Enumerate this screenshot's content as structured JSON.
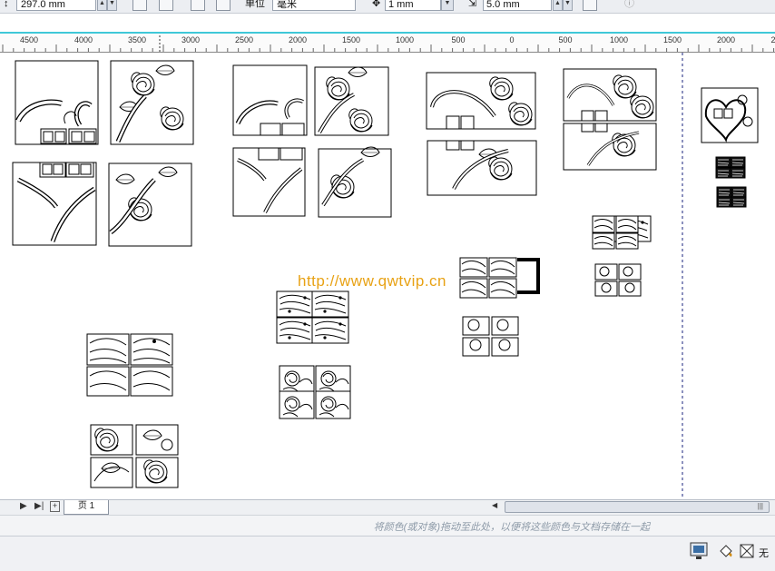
{
  "toolbar": {
    "page_height_value": "297.0 mm",
    "nudge_value": "1 mm",
    "duplicate_distance_value": "5.0 mm",
    "units_label": "单位",
    "units_value": "毫米"
  },
  "ruler": {
    "labels": [
      "4500",
      "4000",
      "3500",
      "3000",
      "2500",
      "2000",
      "1500",
      "1000",
      "500",
      "0",
      "500",
      "1000",
      "1500",
      "2000",
      "2"
    ]
  },
  "canvas": {
    "watermark": "http://www.qwtvip.cn"
  },
  "pagebar": {
    "nav_prev": "▶",
    "nav_last": "▶|",
    "add_page": "+",
    "page_tab": "页 1",
    "scroll_left": "◀",
    "scroll_grip": "|||"
  },
  "palettebar": {
    "hint": "将颜色(或对象)拖动至此处，以便将这些颜色与文档存储在一起"
  },
  "statusbar": {
    "fill_none": "无"
  }
}
